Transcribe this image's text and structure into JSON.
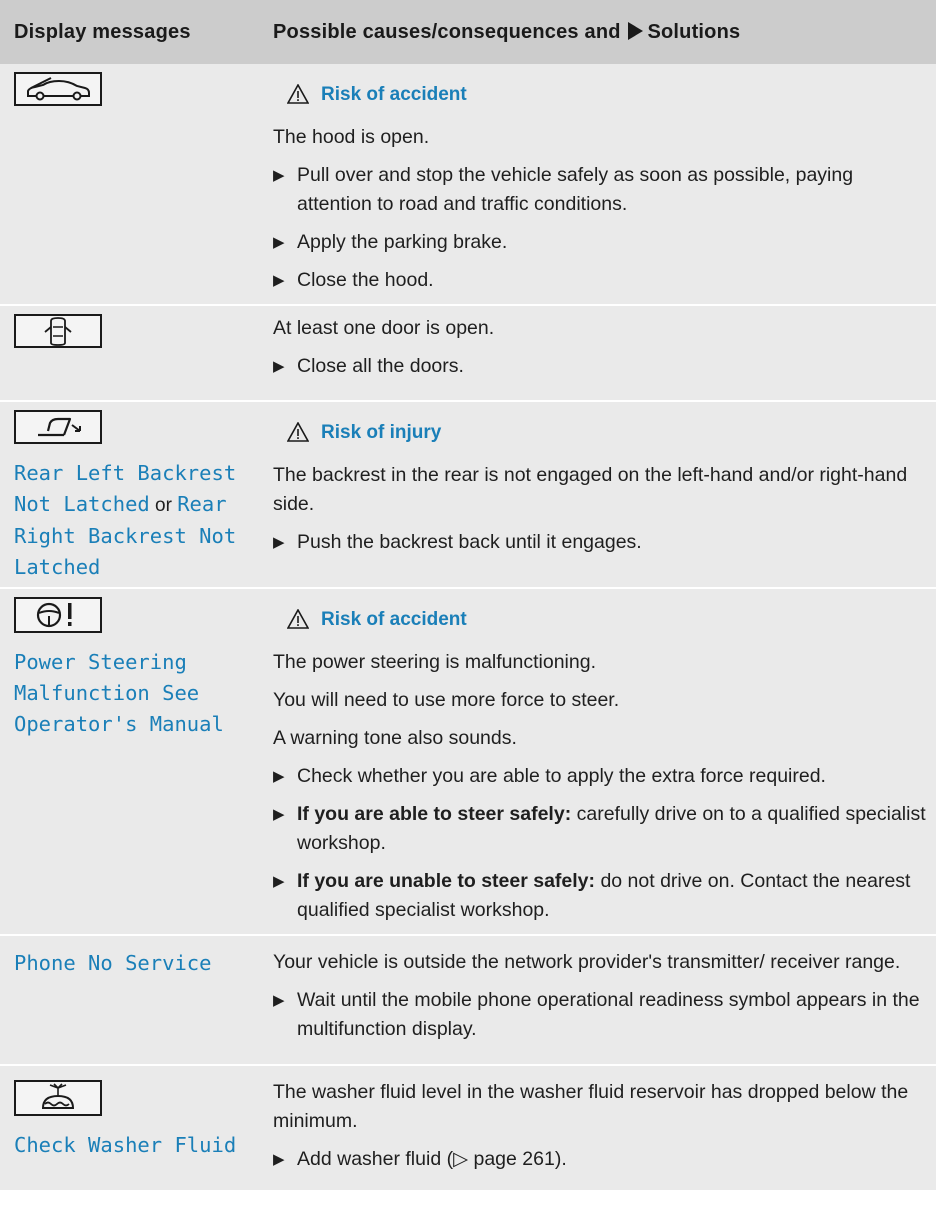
{
  "header": {
    "col1": "Display messages",
    "col2_prefix": "Possible causes/consequences and",
    "col2_suffix": "Solutions"
  },
  "rows": [
    {
      "icon": "hood-open-icon",
      "warning": "Risk of accident",
      "texts": [
        "The hood is open."
      ],
      "steps": [
        "Pull over and stop the vehicle safely as soon as possible, paying attention to road and traffic conditions.",
        "Apply the parking brake.",
        "Close the hood."
      ]
    },
    {
      "icon": "door-open-icon",
      "texts": [
        "At least one door is open."
      ],
      "steps": [
        "Close all the doors."
      ]
    },
    {
      "icon": "backrest-icon",
      "message_a": "Rear Left Backrest Not Latched",
      "connector": "or",
      "message_b": "Rear Right Backrest Not Latched",
      "warning": "Risk of injury",
      "texts": [
        "The backrest in the rear is not engaged on the left-hand and/or right-hand side."
      ],
      "steps": [
        "Push the backrest back until it engages."
      ]
    },
    {
      "icon": "steering-warning-icon",
      "message": "Power Steering Malfunction See Operator's Manual",
      "warning": "Risk of accident",
      "texts": [
        "The power steering is malfunctioning.",
        "You will need to use more force to steer.",
        "A warning tone also sounds."
      ],
      "steps": [
        "Check whether you are able to apply the extra force required."
      ],
      "bold_steps": [
        {
          "bold": "If you are able to steer safely:",
          "rest": "carefully drive on to a qualified specialist workshop."
        },
        {
          "bold": "If you are unable to steer safely:",
          "rest": "do not drive on. Contact the nearest qualified specialist workshop."
        }
      ]
    },
    {
      "message": "Phone No Service",
      "texts": [
        "Your vehicle is outside the network provider's transmitter/ receiver range."
      ],
      "steps": [
        "Wait until the mobile phone operational readiness symbol appears in the multifunction display."
      ]
    },
    {
      "icon": "washer-fluid-icon",
      "message": "Check Washer Fluid",
      "texts": [
        "The washer fluid level in the washer fluid reservoir has dropped below the minimum."
      ],
      "steps": [
        "Add washer fluid (▷ page 261)."
      ]
    }
  ]
}
